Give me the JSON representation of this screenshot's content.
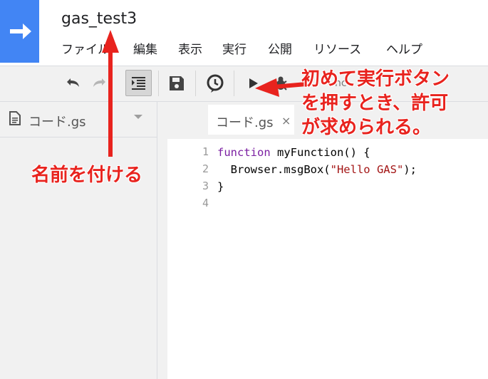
{
  "app": {
    "title": "gas_test3"
  },
  "menubar": {
    "items": [
      "ファイル",
      "編集",
      "表示",
      "実行",
      "公開",
      "リソース",
      "ヘルプ"
    ]
  },
  "toolbar": {
    "buttons": [
      "undo-icon",
      "redo-icon",
      "indent-icon",
      "save-icon",
      "triggers-clock-icon",
      "run-icon",
      "debug-bug-icon"
    ],
    "function_select_partial": "nc"
  },
  "sidebar": {
    "file_name": "コード.gs"
  },
  "editor": {
    "tab_label": "コード.gs",
    "tab_close": "×",
    "line_numbers": [
      "1",
      "2",
      "3",
      "4"
    ],
    "code": {
      "line1_keyword": "function",
      "line1_rest": " myFunction() {",
      "line2_prefix": "  Browser.msgBox(",
      "line2_string": "\"Hello GAS\"",
      "line2_suffix": ");",
      "line3": "}"
    }
  },
  "annotations": {
    "name_note": "名前を付ける",
    "run_note_line1": "初めて実行ボタン",
    "run_note_line2": "を押すとき、許可",
    "run_note_line3": "が求められる。",
    "color": "#e8231e"
  }
}
